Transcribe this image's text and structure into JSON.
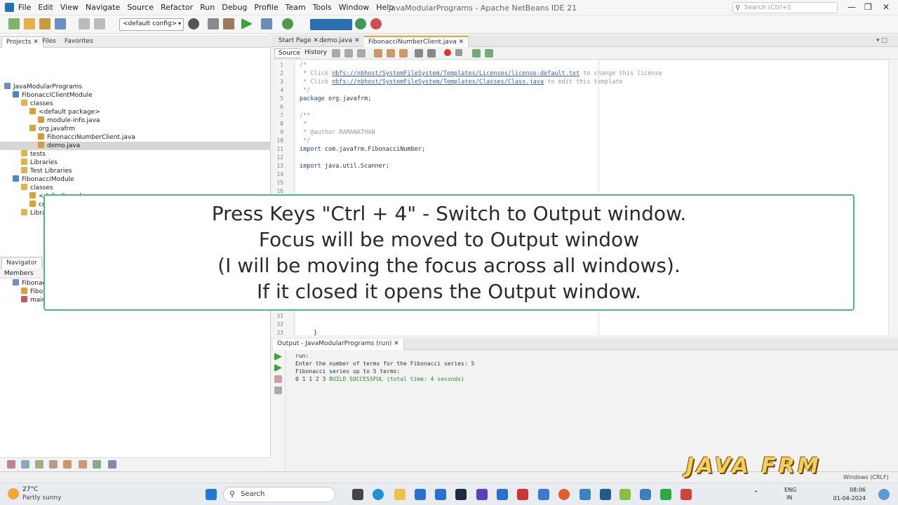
{
  "window": {
    "title": "JavaModularPrograms - Apache NetBeans IDE 21",
    "menus": [
      "File",
      "Edit",
      "View",
      "Navigate",
      "Source",
      "Refactor",
      "Run",
      "Debug",
      "Profile",
      "Team",
      "Tools",
      "Window",
      "Help"
    ],
    "search_placeholder": "Search (Ctrl+I)",
    "config": "<default config>"
  },
  "projects": {
    "tabs": [
      "Projects",
      "Files",
      "Favorites"
    ],
    "tree": [
      {
        "label": "JavaModularPrograms",
        "indent": 0
      },
      {
        "label": "FibonacciClientModule",
        "indent": 1
      },
      {
        "label": "classes",
        "indent": 2
      },
      {
        "label": "<default package>",
        "indent": 3
      },
      {
        "label": "module-info.java",
        "indent": 4
      },
      {
        "label": "org.javafrm",
        "indent": 3
      },
      {
        "label": "FibonacciNumberClient.java",
        "indent": 4
      },
      {
        "label": "demo.java",
        "indent": 4,
        "selected": true
      },
      {
        "label": "tests",
        "indent": 2
      },
      {
        "label": "Libraries",
        "indent": 2
      },
      {
        "label": "Test Libraries",
        "indent": 2
      },
      {
        "label": "FibonacciModule",
        "indent": 1
      },
      {
        "label": "classes",
        "indent": 2
      },
      {
        "label": "<default package>",
        "indent": 3
      },
      {
        "label": "com.javafrm",
        "indent": 3
      },
      {
        "label": "Libraries",
        "indent": 2
      }
    ]
  },
  "navigator": {
    "title": "Navigator",
    "members_label": "Members",
    "items": [
      "Fibonacc",
      "Fibon",
      "main"
    ]
  },
  "editor": {
    "tabs": [
      "Start Page",
      "demo.java",
      "FibonacciNumberClient.java"
    ],
    "source_label": "Source",
    "history_label": "History",
    "line_numbers": [
      "1",
      "2",
      "3",
      "4",
      "5",
      "6",
      "7",
      "8",
      "9",
      "10",
      "11",
      "12",
      "13",
      "14",
      "15",
      "16"
    ],
    "bottom_line_numbers": [
      "31",
      "32",
      "33"
    ],
    "lines": [
      {
        "parts": [
          {
            "t": "/*",
            "c": "cmt"
          }
        ]
      },
      {
        "parts": [
          {
            "t": " * Click ",
            "c": "cmt"
          },
          {
            "t": "nbfs://nbhost/SystemFileSystem/Templates/Licenses/license-default.txt",
            "c": "lnk"
          },
          {
            "t": " to change this license",
            "c": "cmt"
          }
        ]
      },
      {
        "parts": [
          {
            "t": " * Click ",
            "c": "cmt"
          },
          {
            "t": "nbfs://nbhost/SystemFileSystem/Templates/Classes/Class.java",
            "c": "lnk"
          },
          {
            "t": " to edit this template",
            "c": "cmt"
          }
        ]
      },
      {
        "parts": [
          {
            "t": " */",
            "c": "cmt"
          }
        ]
      },
      {
        "parts": [
          {
            "t": "package",
            "c": "kw"
          },
          {
            "t": " org.javafrm;",
            "c": ""
          }
        ]
      },
      {
        "parts": []
      },
      {
        "parts": [
          {
            "t": "/**",
            "c": "cmt"
          }
        ]
      },
      {
        "parts": [
          {
            "t": " *",
            "c": "cmt"
          }
        ]
      },
      {
        "parts": [
          {
            "t": " * @author RAMANATHAN",
            "c": "cmt"
          }
        ]
      },
      {
        "parts": [
          {
            "t": " */",
            "c": "cmt"
          }
        ]
      },
      {
        "parts": [
          {
            "t": "import",
            "c": "kw"
          },
          {
            "t": " com.javafrm.FibonacciNumber;",
            "c": ""
          }
        ]
      },
      {
        "parts": []
      },
      {
        "parts": [
          {
            "t": "import",
            "c": "kw"
          },
          {
            "t": " java.util.Scanner;",
            "c": ""
          }
        ]
      },
      {
        "parts": []
      },
      {
        "parts": []
      },
      {
        "parts": []
      }
    ]
  },
  "output": {
    "tab": "Output - JavaModularPrograms (run)",
    "lines": [
      {
        "t": "run:",
        "c": ""
      },
      {
        "t": "Enter the number of terms for the Fibonacci series: 5",
        "c": ""
      },
      {
        "t": "Fibonacci series up to 5 terms:",
        "c": ""
      }
    ],
    "last_prefix": "0 1 1 2 3 ",
    "last_status": "BUILD SUCCESSFUL (total time: 4 seconds)"
  },
  "statusbar": {
    "right": "Windows (CRLF)"
  },
  "caption": {
    "lines": [
      "Press Keys \"Ctrl + 4\" - Switch to Output window.",
      "Focus will be moved to Output window",
      "(I will be moving the focus across all windows).",
      "If it closed it opens the Output window."
    ]
  },
  "watermark": "JAVA FRM",
  "taskbar": {
    "temperature": "27°C",
    "weather": "Partly sunny",
    "search": "Search",
    "lang_top": "ENG",
    "lang_bottom": "IN",
    "time": "08:06",
    "date": "01-04-2024"
  },
  "colors": {
    "accent_tab": "#f4a03c",
    "caption_border": "#4db886",
    "build_ok": "#2a8a2a",
    "keyword": "#1a3fb5"
  }
}
